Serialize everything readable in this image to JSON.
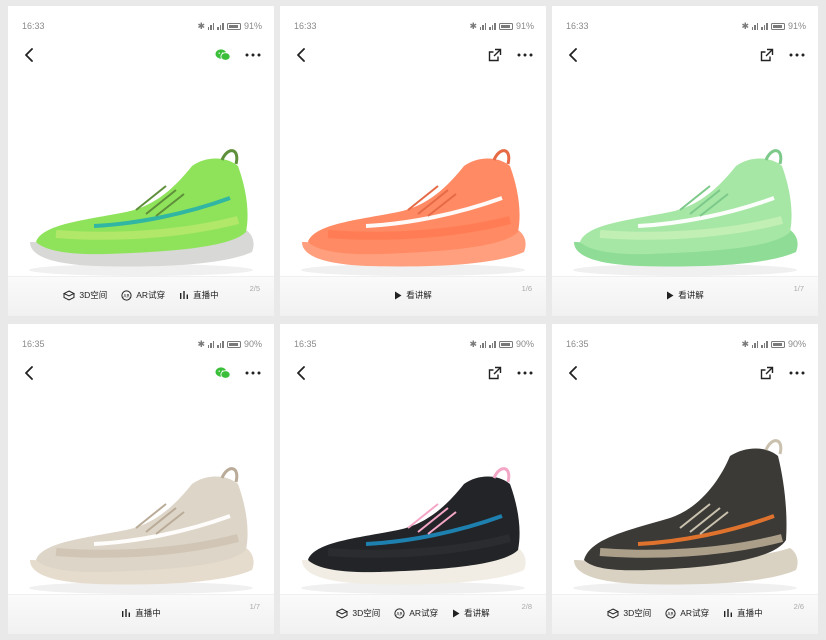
{
  "panels": [
    {
      "status": {
        "time": "16:33",
        "battery": "91%"
      },
      "share_type": "wechat",
      "shoe": {
        "upper": "#8fe35a",
        "accent": "#2bb3a6",
        "sole": "#d8d8d6",
        "mid": "#b5e86a",
        "lace": "#5e8f3a"
      },
      "actions": [
        {
          "label": "3D空间",
          "icon": "3d-space-icon"
        },
        {
          "label": "AR试穿",
          "icon": "ar-icon"
        },
        {
          "label": "直播中",
          "icon": "live-bars-icon"
        }
      ],
      "counter": "2/5"
    },
    {
      "status": {
        "time": "16:33",
        "battery": "91%"
      },
      "share_type": "export",
      "shoe": {
        "upper": "#ff8a63",
        "accent": "#ffffff",
        "sole": "#ff9f7d",
        "mid": "#ff7a52",
        "lace": "#e56a45"
      },
      "actions": [
        {
          "label": "看讲解",
          "icon": "play-icon"
        }
      ],
      "counter": "1/6"
    },
    {
      "status": {
        "time": "16:33",
        "battery": "91%"
      },
      "share_type": "export",
      "shoe": {
        "upper": "#a6e7a6",
        "accent": "#ffffff",
        "sole": "#8edc95",
        "mid": "#c4efb6",
        "lace": "#7cc98a"
      },
      "actions": [
        {
          "label": "看讲解",
          "icon": "play-icon"
        }
      ],
      "counter": "1/7"
    },
    {
      "status": {
        "time": "16:35",
        "battery": "90%"
      },
      "share_type": "wechat",
      "shoe": {
        "upper": "#ddd5c8",
        "accent": "#ffffff",
        "sole": "#e6dccd",
        "mid": "#cfc3b2",
        "lace": "#b9ab97"
      },
      "actions": [
        {
          "label": "直播中",
          "icon": "live-bars-icon"
        }
      ],
      "counter": "1/7"
    },
    {
      "status": {
        "time": "16:35",
        "battery": "90%"
      },
      "share_type": "export",
      "shoe": {
        "upper": "#222427",
        "accent": "#1f86b5",
        "sole": "#f1ede4",
        "mid": "#2b2d31",
        "lace": "#f4a6c6"
      },
      "actions": [
        {
          "label": "3D空间",
          "icon": "3d-space-icon"
        },
        {
          "label": "AR试穿",
          "icon": "ar-icon"
        },
        {
          "label": "看讲解",
          "icon": "play-icon"
        }
      ],
      "counter": "2/8"
    },
    {
      "status": {
        "time": "16:35",
        "battery": "90%"
      },
      "share_type": "export",
      "shoe": {
        "upper": "#3b3a37",
        "accent": "#e8762d",
        "sole": "#d9d2c2",
        "mid": "#b8ab93",
        "lace": "#c9c0ae"
      },
      "actions": [
        {
          "label": "3D空间",
          "icon": "3d-space-icon"
        },
        {
          "label": "AR试穿",
          "icon": "ar-icon"
        },
        {
          "label": "直播中",
          "icon": "live-bars-icon"
        }
      ],
      "counter": "2/6"
    }
  ]
}
